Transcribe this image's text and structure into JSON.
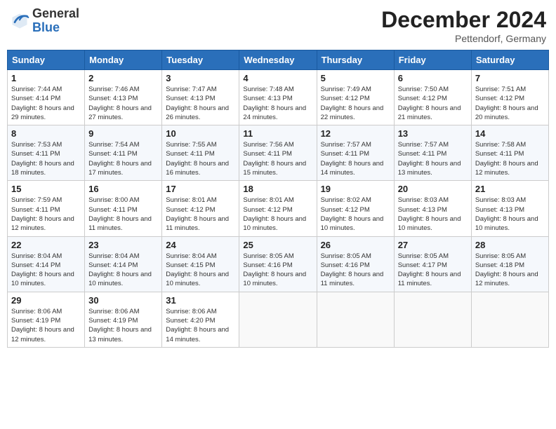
{
  "header": {
    "logo_general": "General",
    "logo_blue": "Blue",
    "month_title": "December 2024",
    "location": "Pettendorf, Germany"
  },
  "days_of_week": [
    "Sunday",
    "Monday",
    "Tuesday",
    "Wednesday",
    "Thursday",
    "Friday",
    "Saturday"
  ],
  "weeks": [
    [
      {
        "day": "1",
        "sunrise": "7:44 AM",
        "sunset": "4:14 PM",
        "daylight": "8 hours and 29 minutes."
      },
      {
        "day": "2",
        "sunrise": "7:46 AM",
        "sunset": "4:13 PM",
        "daylight": "8 hours and 27 minutes."
      },
      {
        "day": "3",
        "sunrise": "7:47 AM",
        "sunset": "4:13 PM",
        "daylight": "8 hours and 26 minutes."
      },
      {
        "day": "4",
        "sunrise": "7:48 AM",
        "sunset": "4:13 PM",
        "daylight": "8 hours and 24 minutes."
      },
      {
        "day": "5",
        "sunrise": "7:49 AM",
        "sunset": "4:12 PM",
        "daylight": "8 hours and 22 minutes."
      },
      {
        "day": "6",
        "sunrise": "7:50 AM",
        "sunset": "4:12 PM",
        "daylight": "8 hours and 21 minutes."
      },
      {
        "day": "7",
        "sunrise": "7:51 AM",
        "sunset": "4:12 PM",
        "daylight": "8 hours and 20 minutes."
      }
    ],
    [
      {
        "day": "8",
        "sunrise": "7:53 AM",
        "sunset": "4:11 PM",
        "daylight": "8 hours and 18 minutes."
      },
      {
        "day": "9",
        "sunrise": "7:54 AM",
        "sunset": "4:11 PM",
        "daylight": "8 hours and 17 minutes."
      },
      {
        "day": "10",
        "sunrise": "7:55 AM",
        "sunset": "4:11 PM",
        "daylight": "8 hours and 16 minutes."
      },
      {
        "day": "11",
        "sunrise": "7:56 AM",
        "sunset": "4:11 PM",
        "daylight": "8 hours and 15 minutes."
      },
      {
        "day": "12",
        "sunrise": "7:57 AM",
        "sunset": "4:11 PM",
        "daylight": "8 hours and 14 minutes."
      },
      {
        "day": "13",
        "sunrise": "7:57 AM",
        "sunset": "4:11 PM",
        "daylight": "8 hours and 13 minutes."
      },
      {
        "day": "14",
        "sunrise": "7:58 AM",
        "sunset": "4:11 PM",
        "daylight": "8 hours and 12 minutes."
      }
    ],
    [
      {
        "day": "15",
        "sunrise": "7:59 AM",
        "sunset": "4:11 PM",
        "daylight": "8 hours and 12 minutes."
      },
      {
        "day": "16",
        "sunrise": "8:00 AM",
        "sunset": "4:11 PM",
        "daylight": "8 hours and 11 minutes."
      },
      {
        "day": "17",
        "sunrise": "8:01 AM",
        "sunset": "4:12 PM",
        "daylight": "8 hours and 11 minutes."
      },
      {
        "day": "18",
        "sunrise": "8:01 AM",
        "sunset": "4:12 PM",
        "daylight": "8 hours and 10 minutes."
      },
      {
        "day": "19",
        "sunrise": "8:02 AM",
        "sunset": "4:12 PM",
        "daylight": "8 hours and 10 minutes."
      },
      {
        "day": "20",
        "sunrise": "8:03 AM",
        "sunset": "4:13 PM",
        "daylight": "8 hours and 10 minutes."
      },
      {
        "day": "21",
        "sunrise": "8:03 AM",
        "sunset": "4:13 PM",
        "daylight": "8 hours and 10 minutes."
      }
    ],
    [
      {
        "day": "22",
        "sunrise": "8:04 AM",
        "sunset": "4:14 PM",
        "daylight": "8 hours and 10 minutes."
      },
      {
        "day": "23",
        "sunrise": "8:04 AM",
        "sunset": "4:14 PM",
        "daylight": "8 hours and 10 minutes."
      },
      {
        "day": "24",
        "sunrise": "8:04 AM",
        "sunset": "4:15 PM",
        "daylight": "8 hours and 10 minutes."
      },
      {
        "day": "25",
        "sunrise": "8:05 AM",
        "sunset": "4:16 PM",
        "daylight": "8 hours and 10 minutes."
      },
      {
        "day": "26",
        "sunrise": "8:05 AM",
        "sunset": "4:16 PM",
        "daylight": "8 hours and 11 minutes."
      },
      {
        "day": "27",
        "sunrise": "8:05 AM",
        "sunset": "4:17 PM",
        "daylight": "8 hours and 11 minutes."
      },
      {
        "day": "28",
        "sunrise": "8:05 AM",
        "sunset": "4:18 PM",
        "daylight": "8 hours and 12 minutes."
      }
    ],
    [
      {
        "day": "29",
        "sunrise": "8:06 AM",
        "sunset": "4:19 PM",
        "daylight": "8 hours and 12 minutes."
      },
      {
        "day": "30",
        "sunrise": "8:06 AM",
        "sunset": "4:19 PM",
        "daylight": "8 hours and 13 minutes."
      },
      {
        "day": "31",
        "sunrise": "8:06 AM",
        "sunset": "4:20 PM",
        "daylight": "8 hours and 14 minutes."
      },
      null,
      null,
      null,
      null
    ]
  ],
  "labels": {
    "sunrise": "Sunrise:",
    "sunset": "Sunset:",
    "daylight": "Daylight:"
  }
}
